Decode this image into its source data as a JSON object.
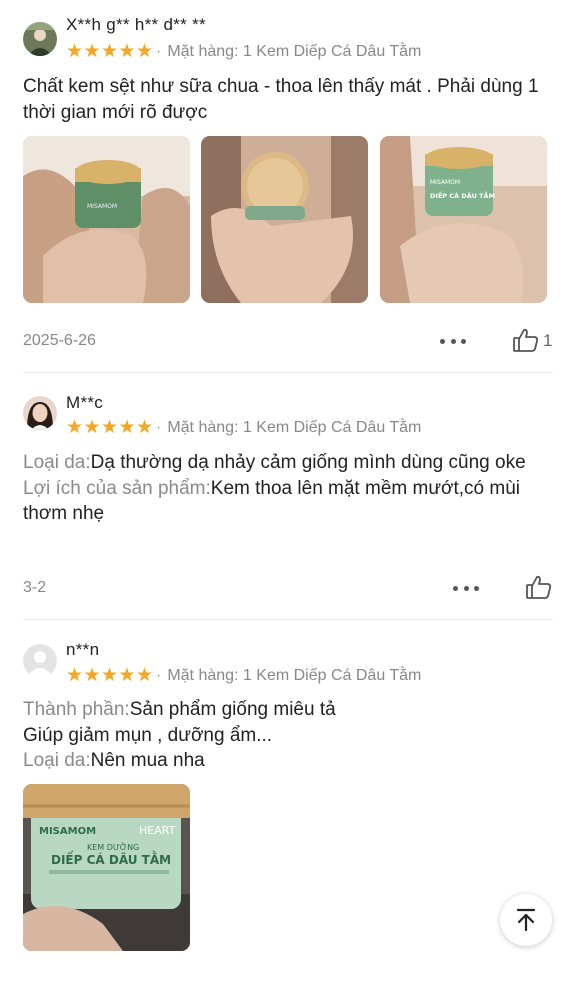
{
  "reviews": [
    {
      "username": "X**h g** h** d** **",
      "variation": "Mặt hàng: 1 Kem Diếp Cá Dâu Tằm",
      "text": "Chất kem sệt như sữa chua - thoa lên thấy mát . Phải dùng 1 thời gian mới rõ được",
      "date": "2025-6-26",
      "likes": "1",
      "rating": 5
    },
    {
      "username": "M**c",
      "variation": "Mặt hàng: 1 Kem Diếp Cá Dâu Tằm",
      "skin_label": "Loại da:",
      "skin_value": "Dạ thường dạ nhảy cảm giống mình dùng cũng oke",
      "benefit_label": "Lợi ích của sản phẩm:",
      "benefit_value": "Kem thoa lên mặt mềm mướt,có mùi thơm nhẹ",
      "date": "3-2",
      "rating": 5
    },
    {
      "username": "n**n",
      "variation": "Mặt hàng: 1 Kem Diếp Cá Dâu Tằm",
      "ingredient_label": "Thành phần:",
      "ingredient_value": "Sản phẩm giống miêu tả",
      "line2": "Giúp giảm mụn , dưỡng ẩm...",
      "skin_label": "Loại da:",
      "skin_value": "Nên mua nha",
      "rating": 5,
      "photo": {
        "brand": "MISAMOM",
        "side": "HEART",
        "sub": "KEM DƯỠNG",
        "title": "DIẾP CÁ DÂU TẰM"
      }
    }
  ],
  "photos_row1": [
    {
      "brand": "MISAMOM"
    },
    {
      "brand": ""
    },
    {
      "brand": "MISAMOM",
      "title": "DIẾP CÁ DÂU TẰM"
    }
  ],
  "colors": {
    "star": "#f5a623",
    "label": "#8a8a8a",
    "divider": "#e8e8e8"
  },
  "icons": {
    "more": "more-dots-icon",
    "like": "thumbs-up-icon",
    "top": "scroll-to-top-icon"
  }
}
